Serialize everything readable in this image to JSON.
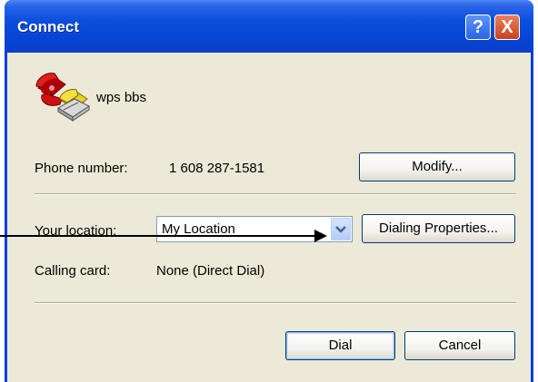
{
  "window": {
    "title": "Connect",
    "help_glyph": "?",
    "close_glyph": "X"
  },
  "entry": {
    "name": "wps bbs",
    "icon": "telephone-icon"
  },
  "phone": {
    "label": "Phone number:",
    "value": "1 608 287-1581",
    "modify_label": "Modify..."
  },
  "location": {
    "label": "Your location:",
    "selected": "My Location",
    "dialing_properties_label": "Dialing Properties..."
  },
  "calling_card": {
    "label": "Calling card:",
    "value": "None (Direct Dial)"
  },
  "actions": {
    "dial_label": "Dial",
    "cancel_label": "Cancel"
  },
  "colors": {
    "titlebar": "#0a4fdc",
    "client_bg": "#ece9d8",
    "close_button": "#c8431d"
  }
}
